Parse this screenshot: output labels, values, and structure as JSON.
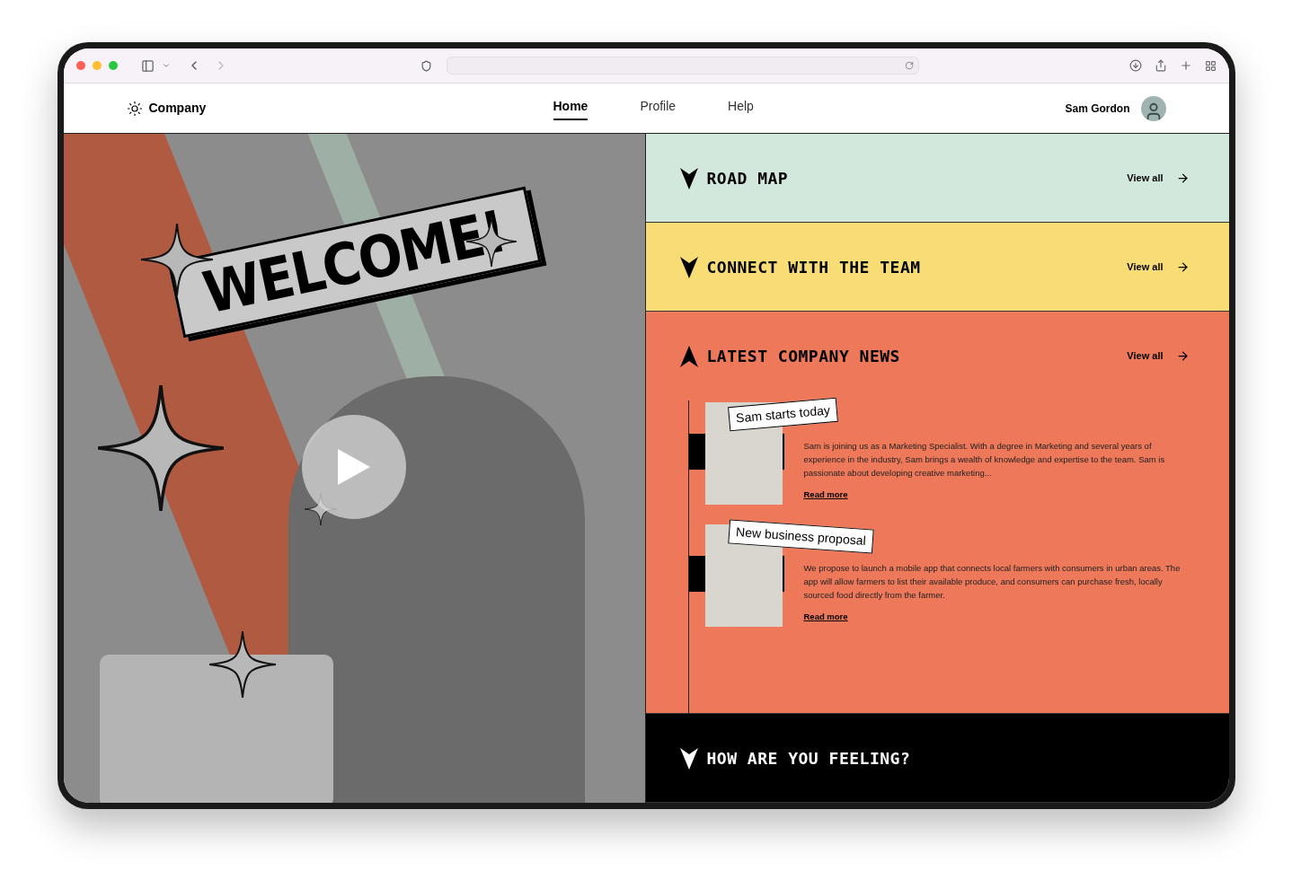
{
  "nav": {
    "brand": "Company",
    "links": [
      {
        "label": "Home",
        "selected": true
      },
      {
        "label": "Profile",
        "selected": false
      },
      {
        "label": "Help",
        "selected": false
      }
    ],
    "user": "Sam Gordon"
  },
  "hero": {
    "sticker": "WELCOME!"
  },
  "sections": [
    {
      "title": "ROAD MAP",
      "color": "#d3e8dc",
      "expanded": false,
      "link": "View all"
    },
    {
      "title": "CONNECT WITH THE TEAM",
      "color": "#f8dc76",
      "expanded": false,
      "link": "View all"
    },
    {
      "title": "LATEST COMPANY NEWS",
      "color": "#ed785a",
      "expanded": true,
      "link": "View all",
      "items": [
        {
          "title": "Sam starts today",
          "text": "Sam is joining us as a Marketing Specialist. With a degree in Marketing and several years of experience in the industry, Sam brings a wealth of knowledge and expertise to the team. Sam is passionate about developing creative marketing...",
          "link": "Read more"
        },
        {
          "title": "New business proposal",
          "text": "We propose to launch a mobile app that connects local farmers with consumers in urban areas. The app will allow farmers to list their available produce, and consumers can purchase fresh, locally sourced food directly from the farmer.",
          "link": "Read more"
        }
      ]
    },
    {
      "title": "HOW ARE YOU FEELING?",
      "color": "#000000",
      "expanded": false
    }
  ]
}
